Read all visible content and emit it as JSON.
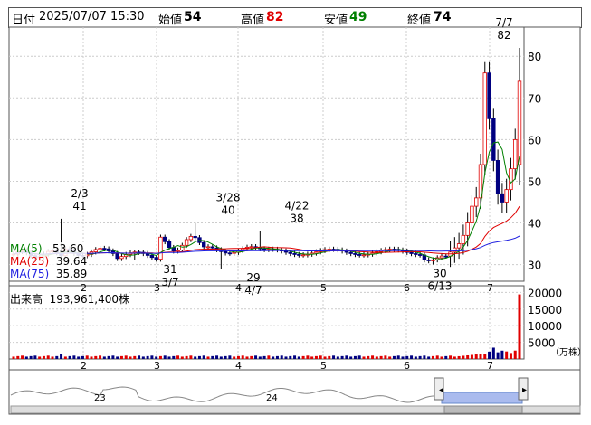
{
  "header": {
    "date_label": "日付",
    "datetime": "2025/07/07 15:30",
    "open_label": "始値",
    "open": "54",
    "high_label": "高値",
    "high": "82",
    "low_label": "安値",
    "low": "49",
    "close_label": "終値",
    "close": "74"
  },
  "ma_legend": [
    {
      "label": "MA(5)",
      "value": "53.60",
      "color": "#008000"
    },
    {
      "label": "MA(25)",
      "value": "39.64",
      "color": "#e00000"
    },
    {
      "label": "MA(75)",
      "value": "35.89",
      "color": "#2020e0"
    }
  ],
  "volume": {
    "label": "出来高",
    "value": "193,961,400株",
    "unit": "（万株）",
    "ticks": [
      "20000",
      "15000",
      "10000",
      "5000"
    ]
  },
  "navigator": {
    "labels": [
      "23",
      "24"
    ]
  },
  "colors": {
    "up": "#e00000",
    "down": "#000080",
    "grid": "#cccccc",
    "accent_nav": "#aabbee"
  },
  "chart_data": {
    "type": "candlestick",
    "y_ticks": [
      "80",
      "70",
      "60",
      "50",
      "40",
      "30"
    ],
    "ylim": [
      26,
      87
    ],
    "x_month_ticks": [
      "2",
      "3",
      "4",
      "5",
      "6",
      "7"
    ],
    "annotations": [
      {
        "date": "2/3",
        "value": "41"
      },
      {
        "date": "3/7",
        "value": "31"
      },
      {
        "date": "3/28",
        "value": "40"
      },
      {
        "date": "4/7",
        "value": "29"
      },
      {
        "date": "4/22",
        "value": "38"
      },
      {
        "date": "6/13",
        "value": "30"
      },
      {
        "date": "7/7",
        "value": "82"
      }
    ],
    "last_candle": {
      "date": "2025/07/07",
      "open": 54,
      "high": 82,
      "low": 49,
      "close": 74
    },
    "ma_last": {
      "MA(5)": 53.6,
      "MA(25)": 39.64,
      "MA(75)": 35.89
    },
    "volume_last": 193961400,
    "volume_ylim": [
      0,
      22000
    ]
  }
}
